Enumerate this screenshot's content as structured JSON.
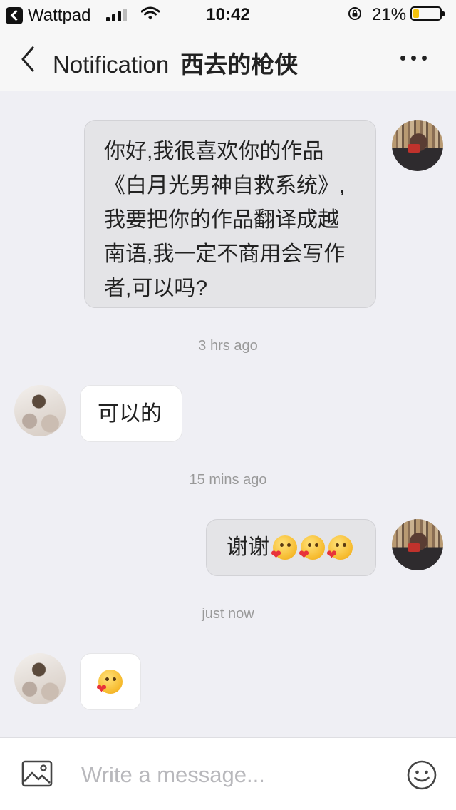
{
  "status_bar": {
    "back_app": "Wattpad",
    "time": "10:42",
    "battery_percent": "21%",
    "battery_level": 0.21,
    "battery_color": "#f4c20d"
  },
  "nav": {
    "title": "Notification",
    "username": "西去的枪侠",
    "back_icon": "chevron-left-icon",
    "more_icon": "ellipsis-icon"
  },
  "messages": [
    {
      "sender": "me",
      "lines": [
        "你好,我很喜欢你的作品",
        "《白月光男神自救系统》,",
        "我要把你的作品翻译成越",
        "南语,我一定不商用会写作",
        "者,可以吗?"
      ]
    },
    {
      "timestamp": "3 hrs ago"
    },
    {
      "sender": "them",
      "text": "可以的"
    },
    {
      "timestamp": "15 mins ago"
    },
    {
      "sender": "me",
      "text": "谢谢",
      "emoji_count": 3,
      "emoji": "hug-emoji"
    },
    {
      "timestamp": "just now"
    },
    {
      "sender": "them",
      "emoji_count": 1,
      "emoji": "hug-emoji"
    }
  ],
  "input": {
    "placeholder": "Write a message...",
    "image_icon": "image-icon",
    "emoji_icon": "smiley-icon"
  },
  "colors": {
    "background": "#efeff4",
    "my_bubble": "#e4e4e7",
    "their_bubble": "#ffffff",
    "timestamp": "#999999"
  }
}
